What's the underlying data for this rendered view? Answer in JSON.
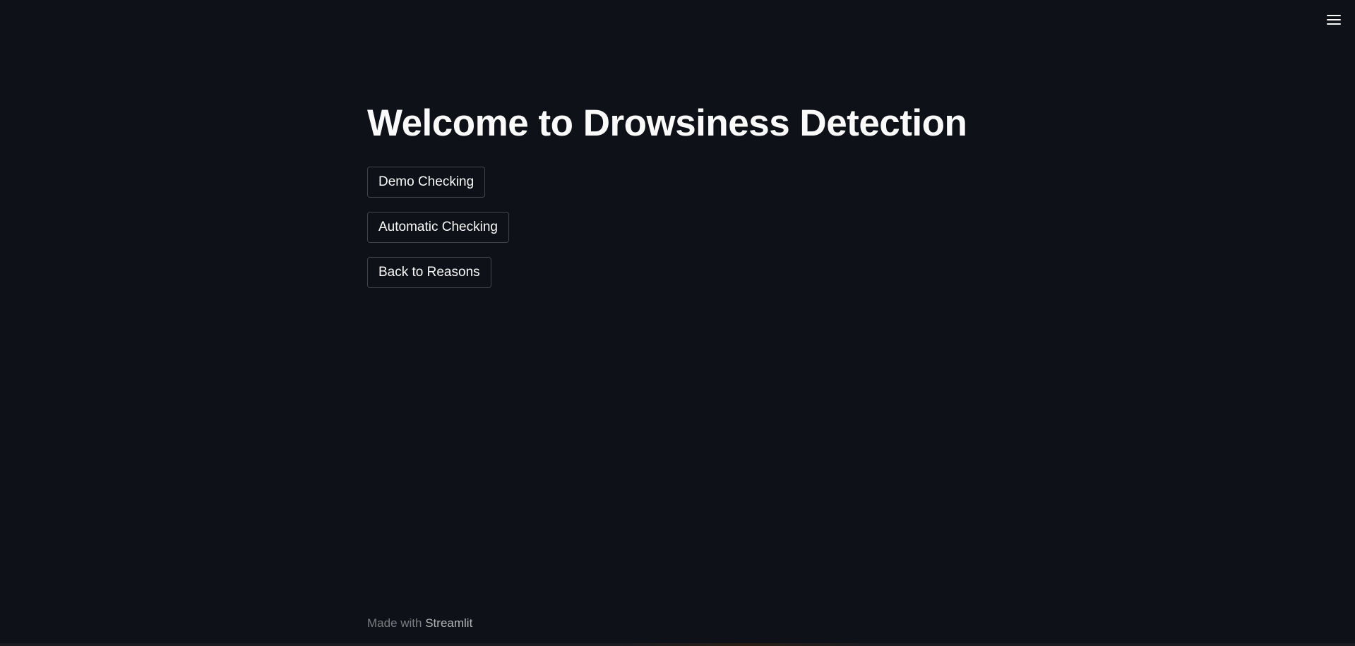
{
  "header": {
    "menu_icon": "hamburger-menu-icon"
  },
  "main": {
    "title": "Welcome to Drowsiness Detection",
    "buttons": [
      {
        "label": "Demo Checking"
      },
      {
        "label": "Automatic Checking"
      },
      {
        "label": "Back to Reasons"
      }
    ]
  },
  "footer": {
    "prefix": "Made with",
    "link": "Streamlit"
  },
  "colors": {
    "background": "#0e1117",
    "text": "#fafafa",
    "button_border": "#3a3d45"
  }
}
